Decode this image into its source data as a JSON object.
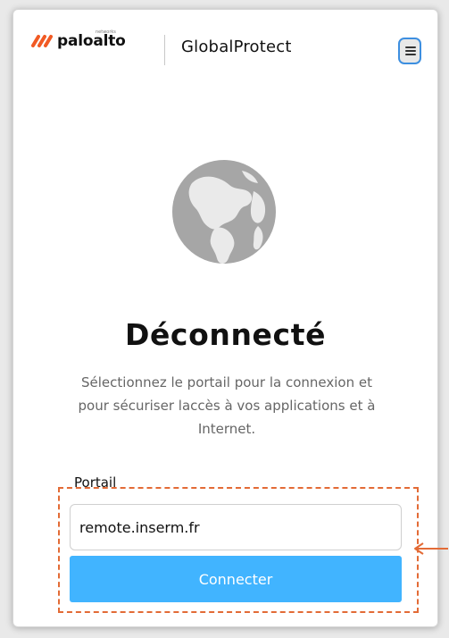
{
  "header": {
    "brand_name": "paloalto",
    "brand_subtitle": "networks",
    "product_name": "GlobalProtect",
    "menu_icon": "hamburger-menu-icon"
  },
  "status": {
    "icon": "globe-icon",
    "title": "Déconnecté",
    "description": "Sélectionnez le portail pour la connexion et pour sécuriser laccès à vos applications et à Internet."
  },
  "portal": {
    "label": "Portail",
    "value": "remote.inserm.fr"
  },
  "actions": {
    "connect_label": "Connecter"
  },
  "colors": {
    "brand_orange": "#f15a24",
    "menu_focus_border": "#3d8fe0",
    "connect_button": "#41b4ff",
    "annotation": "#e36b36",
    "globe": "#a6a6a6"
  }
}
